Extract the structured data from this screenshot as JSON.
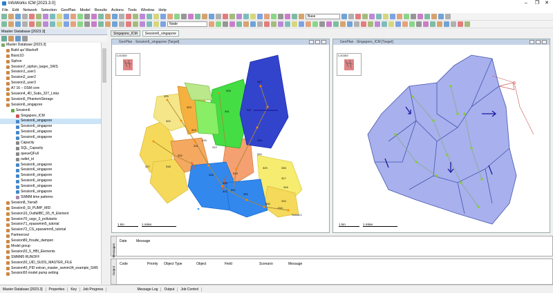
{
  "app": {
    "title": "InfoWorks ICM [2023.3.0]",
    "minimize": "–",
    "maximize": "❐",
    "close": "✕"
  },
  "menu": [
    "File",
    "Edit",
    "Network",
    "Selection",
    "GeoPlan",
    "Model",
    "Results",
    "Actions",
    "Tools",
    "Window",
    "Help"
  ],
  "toolbar": {
    "select1": "Base",
    "select2": "Node"
  },
  "sidebar": {
    "header": "Master Database [2023.3]",
    "tree": [
      {
        "label": "Master Database [2023.3]",
        "depth": 0,
        "icon": "database",
        "color": "#7a6"
      },
      {
        "label": "Build up/ Washoff",
        "depth": 1,
        "icon": "group",
        "color": "#c84"
      },
      {
        "label": "Basic1D",
        "depth": 1,
        "icon": "group",
        "color": "#c84"
      },
      {
        "label": "Siphon",
        "depth": 1,
        "icon": "group",
        "color": "#c84"
      },
      {
        "label": "Session7_siphon_larger_SWS",
        "depth": 1,
        "icon": "group",
        "color": "#c84"
      },
      {
        "label": "Session1_user1",
        "depth": 1,
        "icon": "group",
        "color": "#c84"
      },
      {
        "label": "Session2_user2",
        "depth": 1,
        "icon": "group",
        "color": "#c84"
      },
      {
        "label": "Session3_user3",
        "depth": 1,
        "icon": "group",
        "color": "#c84"
      },
      {
        "label": "A7 16 – OSM core",
        "depth": 1,
        "icon": "group",
        "color": "#c84"
      },
      {
        "label": "Session4_4D_Subs_327_Links",
        "depth": 1,
        "icon": "group",
        "color": "#c84"
      },
      {
        "label": "Session5_PhantomStorage",
        "depth": 1,
        "icon": "group",
        "color": "#c84"
      },
      {
        "label": "Session6_singapore",
        "depth": 1,
        "icon": "group",
        "color": "#c84"
      },
      {
        "label": "Session6",
        "depth": 2,
        "icon": "folder",
        "color": "#6a4"
      },
      {
        "label": "Singapore_ICM",
        "depth": 3,
        "icon": "network",
        "color": "#c55"
      },
      {
        "label": "Session6_singapore",
        "depth": 3,
        "icon": "run",
        "color": "#48c"
      },
      {
        "label": "Session6_singapore",
        "depth": 3,
        "icon": "run",
        "color": "#48c"
      },
      {
        "label": "Session6_singapore",
        "depth": 3,
        "icon": "run",
        "color": "#48c"
      },
      {
        "label": "Session6_singapore",
        "depth": 3,
        "icon": "run",
        "color": "#48c"
      },
      {
        "label": "Capacity",
        "depth": 3,
        "icon": "query",
        "color": "#888"
      },
      {
        "label": "SQL_Capacity",
        "depth": 3,
        "icon": "query",
        "color": "#888"
      },
      {
        "label": "queueQFull",
        "depth": 3,
        "icon": "query",
        "color": "#888"
      },
      {
        "label": "outlet_id",
        "depth": 3,
        "icon": "query",
        "color": "#888"
      },
      {
        "label": "Session6_singapore",
        "depth": 3,
        "icon": "run",
        "color": "#48c"
      },
      {
        "label": "Session6_singapore",
        "depth": 3,
        "icon": "run",
        "color": "#48c"
      },
      {
        "label": "Session6_singapore",
        "depth": 3,
        "icon": "run",
        "color": "#48c"
      },
      {
        "label": "Session6_singapore",
        "depth": 3,
        "icon": "run",
        "color": "#48c"
      },
      {
        "label": "Session6_singapore",
        "depth": 3,
        "icon": "run",
        "color": "#48c"
      },
      {
        "label": "Session6_singapore",
        "depth": 3,
        "icon": "run",
        "color": "#48c"
      },
      {
        "label": "SWMM time patterns",
        "depth": 3,
        "icon": "pattern",
        "color": "#a8a"
      },
      {
        "label": "Session8_Yarra8",
        "depth": 1,
        "icon": "group",
        "color": "#c84"
      },
      {
        "label": "Session9_SI_PUMP_MID",
        "depth": 1,
        "icon": "group",
        "color": "#c84"
      },
      {
        "label": "Session10_OutfallBC_65_H_Element",
        "depth": 1,
        "icon": "group",
        "color": "#c84"
      },
      {
        "label": "Session70_usgs_3_pollutants",
        "depth": 1,
        "icon": "group",
        "color": "#c84"
      },
      {
        "label": "Session71_epaswmm5_tutorial",
        "depth": 1,
        "icon": "group",
        "color": "#c84"
      },
      {
        "label": "Session72_CS_epaswmm5_tutorial",
        "depth": 1,
        "icon": "group",
        "color": "#c84"
      },
      {
        "label": "Partmerced",
        "depth": 1,
        "icon": "group",
        "color": "#c84"
      },
      {
        "label": "Session80_froude_dampen",
        "depth": 1,
        "icon": "group",
        "color": "#c84"
      },
      {
        "label": "Model group",
        "depth": 1,
        "icon": "group",
        "color": "#c84"
      },
      {
        "label": "Session20_5_HBI_Elements",
        "depth": 1,
        "icon": "group",
        "color": "#c84"
      },
      {
        "label": "SWMM5 RUNOFF",
        "depth": 1,
        "icon": "group",
        "color": "#c84"
      },
      {
        "label": "Session30_UID_SUDS_MASTER_FILE",
        "depth": 1,
        "icon": "group",
        "color": "#c84"
      },
      {
        "label": "Session40_PID extran_master_swmm34_example_SW5",
        "depth": 1,
        "icon": "group",
        "color": "#c84"
      },
      {
        "label": "Session50 model pump setting",
        "depth": 1,
        "icon": "group",
        "color": "#c84"
      }
    ]
  },
  "doc_tabs": [
    "Singapore_ICM",
    "Session6_singapore"
  ],
  "left_pane": {
    "title": "GeoPlan - Session6_singapore [Target]",
    "locator": "Locator",
    "scale1": "1 km",
    "scale2": "1 miles",
    "subcatch_labels": [
      "342",
      "325",
      "328",
      "323",
      "341",
      "337",
      "324",
      "313",
      "315",
      "311",
      "312",
      "339",
      "334",
      "327",
      "318",
      "322",
      "326",
      "319",
      "320",
      "321",
      "331",
      "333",
      "330",
      "329",
      "335",
      "317",
      "316",
      "310",
      "314",
      "Outfall 1"
    ]
  },
  "right_pane": {
    "title": "GeoPlan - Singapore_ICM [Target]",
    "locator": "Locator",
    "scale1": "1 km",
    "scale2": "1 miles"
  },
  "messages": {
    "tab": "Messages",
    "cols": [
      "Date",
      "Message"
    ]
  },
  "output": {
    "tab": "Output",
    "cols": [
      "Code",
      "Priority",
      "Object Type",
      "Object",
      "Field",
      "Scenario",
      "Message"
    ]
  },
  "status": [
    "Master Database [2023.3]",
    "Properties",
    "Key",
    "Job Progress",
    "Message Log",
    "Output",
    "Job Control"
  ]
}
